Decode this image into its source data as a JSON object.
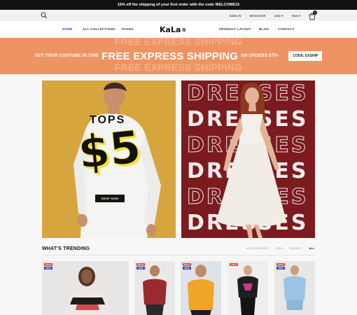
{
  "announcement": "15% off the shipping of your first order with the code WELCOME15",
  "utility": {
    "search_icon": "search-icon",
    "signin": "SIGN IN",
    "register": "REGISTER",
    "currency": "USD",
    "language": "ENG",
    "cart_count": "0"
  },
  "nav": {
    "items_left": [
      "HOME",
      "ALL COLLECTIONS",
      "PAGES"
    ],
    "logo": "KaLa",
    "items_right": [
      "PRODUCT LAYOUT",
      "BLOG",
      "CONTACT"
    ]
  },
  "promo": {
    "left_text": "GET YOUR COSTUME IN TIME",
    "headline": "FREE EXPRESS SHIPPING",
    "right_text": "ON ORDERS $75+",
    "code": "CODE: EXSHIP"
  },
  "banner_left": {
    "label": "TOPS",
    "price": "$5",
    "button": "SHOP NOW"
  },
  "banner_right": {
    "word": "DRESSES"
  },
  "trending": {
    "title": "WHAT'S TRENDING",
    "tabs": [
      "ACCESSORIES",
      "MEN",
      "WOMEN",
      "ALL"
    ],
    "active_tab": "ALL",
    "products": [
      {
        "badges": [
          "SALE",
          "NEW"
        ]
      },
      {
        "badges": [
          "SALE",
          "NEW"
        ]
      },
      {
        "badges": [
          "SALE",
          "NEW"
        ]
      },
      {
        "badges": [
          "SALE"
        ]
      },
      {
        "badges": [
          "SALE",
          "NEW"
        ]
      }
    ]
  },
  "colors": {
    "accent": "#2b49b8",
    "promo": "#ee9463",
    "tops_bg": "#d6a53d",
    "dresses_bg": "#7b1b1f",
    "sale_badge": "#e84340"
  }
}
